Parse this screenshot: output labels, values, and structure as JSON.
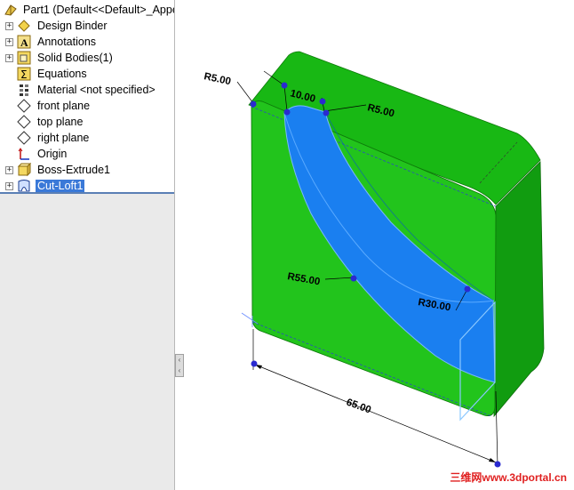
{
  "feature_tree": {
    "part": {
      "label": "Part1  (Default<<Default>_Appe"
    },
    "items": [
      {
        "label": "Design Binder",
        "icon": "design-binder-icon",
        "expandable": true
      },
      {
        "label": "Annotations",
        "icon": "annotations-icon",
        "expandable": true
      },
      {
        "label": "Solid Bodies(1)",
        "icon": "solid-bodies-icon",
        "expandable": true
      },
      {
        "label": "Equations",
        "icon": "equations-icon",
        "expandable": false
      },
      {
        "label": "Material <not specified>",
        "icon": "material-icon",
        "expandable": false
      },
      {
        "label": "front plane",
        "icon": "plane-icon",
        "expandable": false
      },
      {
        "label": "top plane",
        "icon": "plane-icon",
        "expandable": false
      },
      {
        "label": "right plane",
        "icon": "plane-icon",
        "expandable": false
      },
      {
        "label": "Origin",
        "icon": "origin-icon",
        "expandable": false
      },
      {
        "label": "Boss-Extrude1",
        "icon": "boss-extrude-icon",
        "expandable": true
      },
      {
        "label": "Cut-Loft1",
        "icon": "cut-loft-icon",
        "expandable": true,
        "selected": true
      }
    ]
  },
  "dimensions": {
    "r_top_left": "R5.00",
    "width_top": "10.00",
    "r_top_right": "R5.00",
    "r_big": "R55.00",
    "r_small": "R30.00",
    "length_bottom": "65.00"
  },
  "colors": {
    "body_front": "#22c41c",
    "body_top": "#18b814",
    "body_side": "#159a12",
    "cut_surface": "#1a7ff0",
    "selection_blue": "#3a79d8"
  },
  "watermark": "三维网www.3dportal.cn"
}
